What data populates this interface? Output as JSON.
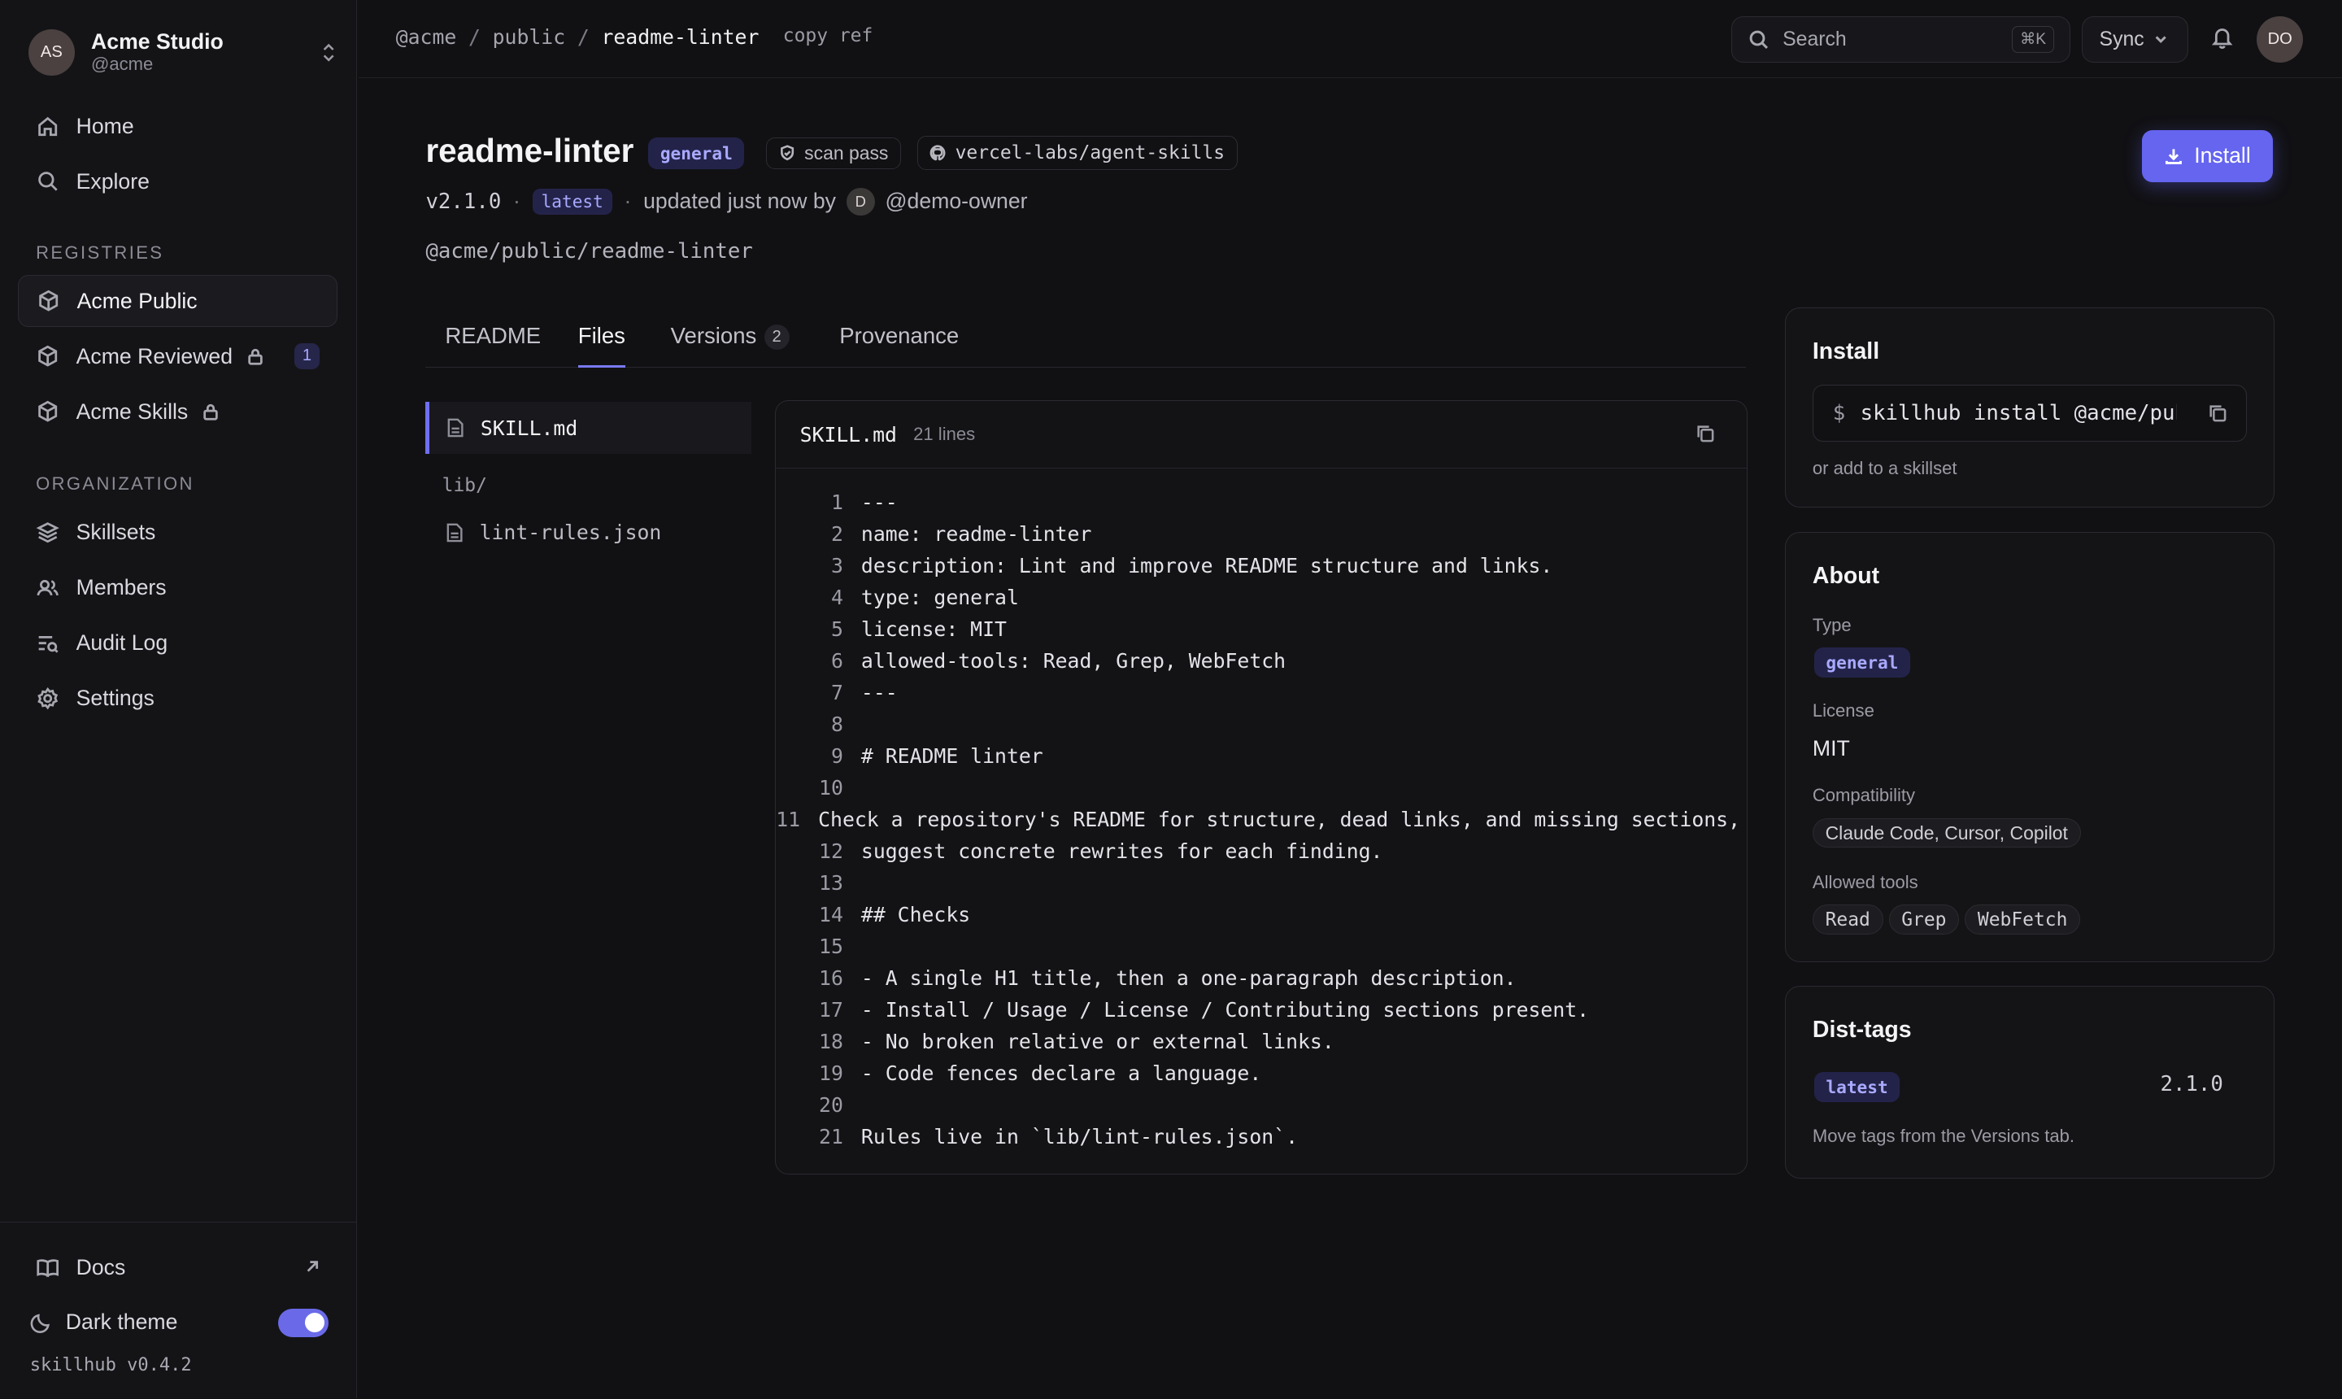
{
  "workspace": {
    "initials": "AS",
    "name": "Acme Studio",
    "handle": "@acme"
  },
  "sidebar": {
    "nav": [
      {
        "label": "Home",
        "icon": "home-icon"
      },
      {
        "label": "Explore",
        "icon": "search-icon"
      }
    ],
    "registries_heading": "REGISTRIES",
    "registries": [
      {
        "label": "Acme Public",
        "active": true
      },
      {
        "label": "Acme Reviewed",
        "locked": true,
        "count": "1"
      },
      {
        "label": "Acme Skills",
        "locked": true
      }
    ],
    "org_heading": "ORGANIZATION",
    "org": [
      {
        "label": "Skillsets",
        "icon": "layers-icon"
      },
      {
        "label": "Members",
        "icon": "users-icon"
      },
      {
        "label": "Audit Log",
        "icon": "audit-log-icon"
      },
      {
        "label": "Settings",
        "icon": "gear-icon"
      }
    ],
    "docs_label": "Docs",
    "theme_label": "Dark theme",
    "theme_on": true,
    "version": "skillhub v0.4.2"
  },
  "topbar": {
    "breadcrumb": [
      "@acme",
      "public",
      "readme-linter"
    ],
    "copy_ref": "copy ref",
    "search_placeholder": "Search",
    "search_shortcut": "⌘K",
    "sync_label": "Sync",
    "user_initials": "DO"
  },
  "skill": {
    "name": "readme-linter",
    "type_badge": "general",
    "scan_badge": "scan pass",
    "repo": "vercel-labs/agent-skills",
    "version": "v2.1.0",
    "version_tag": "latest",
    "updated_text": "updated just now by",
    "owner_initial": "D",
    "owner": "@demo-owner",
    "path": "@acme/public/readme-linter",
    "install_label": "Install"
  },
  "tabs": [
    {
      "label": "README"
    },
    {
      "label": "Files",
      "active": true
    },
    {
      "label": "Versions",
      "count": "2"
    },
    {
      "label": "Provenance"
    }
  ],
  "file_tree": {
    "files": [
      "SKILL.md"
    ],
    "dir": "lib/",
    "dir_files": [
      "lint-rules.json"
    ]
  },
  "viewer": {
    "filename": "SKILL.md",
    "line_count": "21 lines",
    "lines": [
      "---",
      "name: readme-linter",
      "description: Lint and improve README structure and links.",
      "type: general",
      "license: MIT",
      "allowed-tools: Read, Grep, WebFetch",
      "---",
      "",
      "# README linter",
      "",
      "Check a repository's README for structure, dead links, and missing sections, then",
      "suggest concrete rewrites for each finding.",
      "",
      "## Checks",
      "",
      "- A single H1 title, then a one-paragraph description.",
      "- Install / Usage / License / Contributing sections present.",
      "- No broken relative or external links.",
      "- Code fences declare a language.",
      "",
      "Rules live in `lib/lint-rules.json`."
    ]
  },
  "install_card": {
    "title": "Install",
    "prompt": "$",
    "command": "skillhub install @acme/public/readme-linter",
    "note": "or add to a skillset"
  },
  "about": {
    "title": "About",
    "type_label": "Type",
    "type_value": "general",
    "license_label": "License",
    "license_value": "MIT",
    "compat_label": "Compatibility",
    "compat_value": "Claude Code, Cursor, Copilot",
    "tools_label": "Allowed tools",
    "tools": [
      "Read",
      "Grep",
      "WebFetch"
    ]
  },
  "dist_tags": {
    "title": "Dist-tags",
    "tag": "latest",
    "version": "2.1.0",
    "note": "Move tags from the Versions tab."
  },
  "colors": {
    "accent": "#6565f0",
    "background": "#111114",
    "badge_bg": "#23234a",
    "badge_text": "#a9a9ff"
  }
}
